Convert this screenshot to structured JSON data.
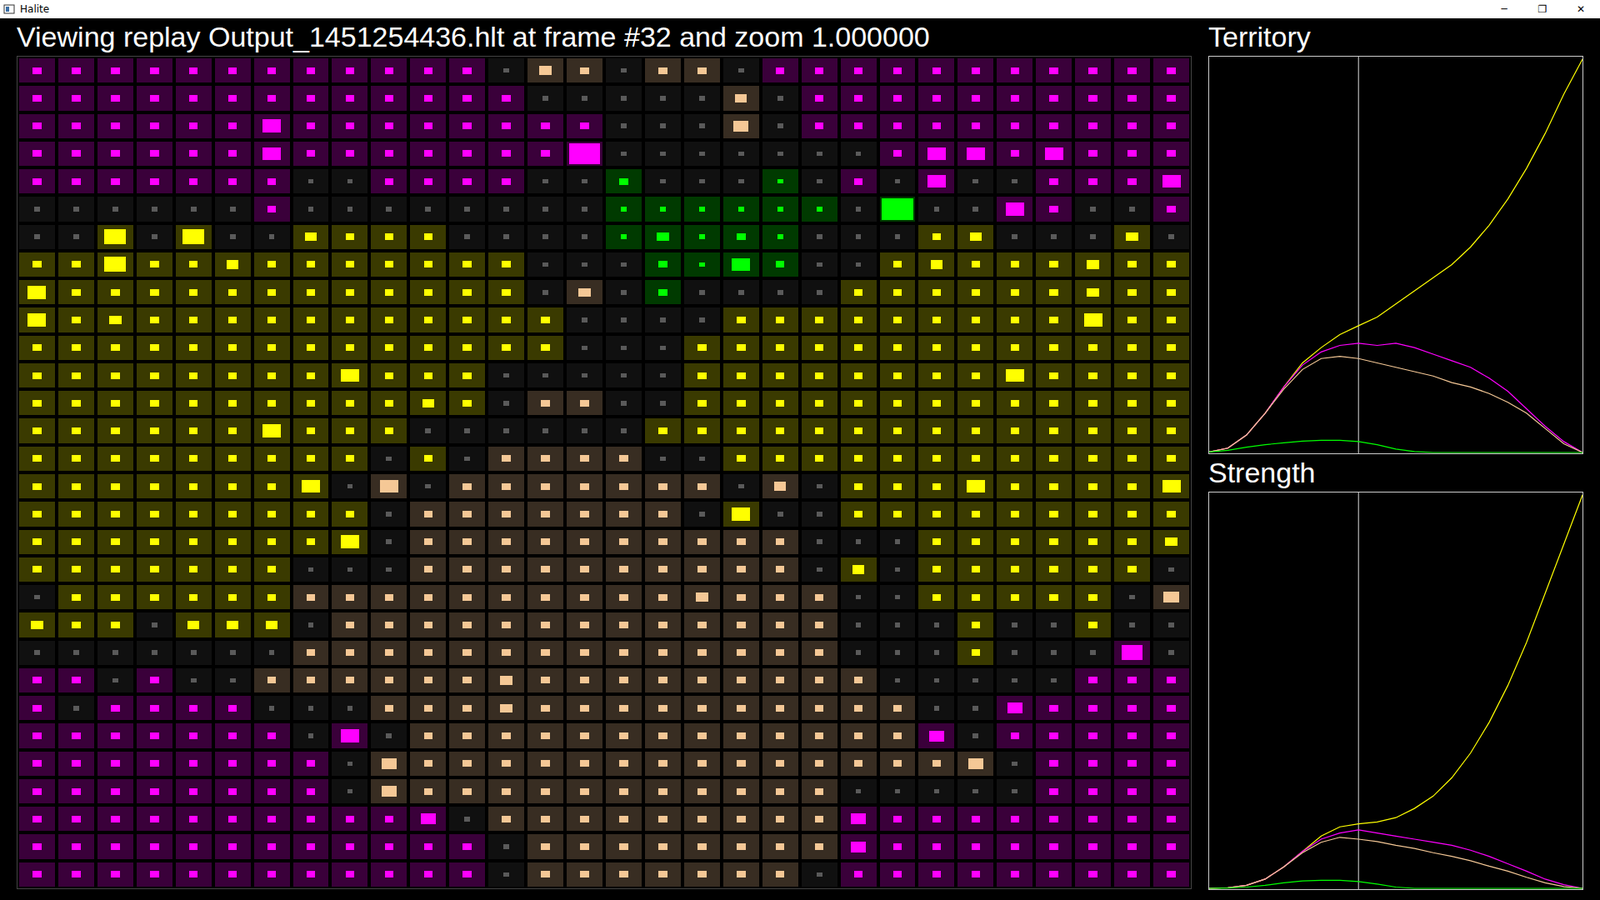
{
  "window": {
    "title": "Halite",
    "controls": [
      "─",
      "❐",
      "✕"
    ]
  },
  "header": "Viewing replay Output_1451254436.hlt at frame #32 and zoom 1.000000",
  "players": [
    {
      "code": "M",
      "color": "#ff00ff"
    },
    {
      "code": "Y",
      "color": "#ffff00"
    },
    {
      "code": "T",
      "color": "#f5c896"
    },
    {
      "code": "G",
      "color": "#00ff00"
    }
  ],
  "map": {
    "rows": [
      {
        "owners": "MMMMMMMMMMMMNTTNTTNMMMMMMMMMMM",
        "strength": "222222222222132122122222222222"
      },
      {
        "owners": "MMMMMMMMMMMMMNNNNNTNMMMMMMMMMM",
        "strength": "222222222222211111312222222222"
      },
      {
        "owners": "MMMMMMMMMMMMMMMNNNTNMMMMMMMMMM",
        "strength": "222222522222222111412222222222"
      },
      {
        "owners": "MMMMMMMMMMMMMMMNNNNNNNMMMMMMMM",
        "strength": "222222522222229111111125525222"
      },
      {
        "owners": "MMMMMMMNNMMMMNNGNNNGNMNMNNMMMM",
        "strength": "222222211222211211111215112225"
      },
      {
        "owners": "NNNNNNMNNNNNNNNGGGGGGNGNNMMNNM",
        "strength": "111111211111111111111191152112"
      },
      {
        "owners": "NNYNYNNYYYYNNNNGGGGGNNNYYNNNYN",
        "strength": "116161132221111131211112311131"
      },
      {
        "owners": "YYYYYYYYYYYYYNNNGGGGNNYYYYYYYY",
        "strength": "226223222222211121521123222322"
      },
      {
        "owners": "YYYYYYYYYYYYYNTNGNNNNYYYYYYYYY",
        "strength": "522222222222213121111222222322"
      },
      {
        "owners": "YYYYYYYYYYYYYYNNNNYYYYYYYYYYYY",
        "strength": "523222222222221111222222222522"
      },
      {
        "owners": "YYYYYYYYYYYYYYNNNYYYYYYYYYYYYY",
        "strength": "222222222222221112222222222222"
      },
      {
        "owners": "YYYYYYYYYYYYNNNNNYYYYYYYYYYYYY",
        "strength": "222222225222111112222222252222"
      },
      {
        "owners": "YYYYYYYYYYYYNTTNNYYYYYYYYYYYYY",
        "strength": "222222222232122112222222222222"
      },
      {
        "owners": "YYYYYYYYYYNNNNNNYYYYYYYYYYYYYY",
        "strength": "222222522211111122222222222222"
      },
      {
        "owners": "YYYYYYYYYNYNTTTTNNYYYYYYYYYYYY",
        "strength": "222222222121222211222222222222"
      },
      {
        "owners": "YYYYYYYYNTNTTTTTTTNTNYYYYYYYYY",
        "strength": "222222251512222222131222522225"
      },
      {
        "owners": "YYYYYYYYYNTTTTTTTNYNNYYYYYYYYY",
        "strength": "222222222122222221511222222222"
      },
      {
        "owners": "YYYYYYYYYNTTTTTTTTTTNNNYYYYYYY",
        "strength": "222222225122222222221112222223"
      },
      {
        "owners": "YYYYYYYNNNTTTTTTTTTTNYNYYYYYYN",
        "strength": "222222211122222222221312222221"
      },
      {
        "owners": "NYYYYYYTTTTTTTTTTTTTTNNYYYYYNT",
        "strength": "122222222222222223222112222214"
      },
      {
        "owners": "YYYNYYYNTTTTTTTTTTTTTNNNYNNYNN",
        "strength": "322133312222222222222111211211"
      },
      {
        "owners": "NNNNNNNTTTTTTTTTTTTTTNNNYNNNMN",
        "strength": "111111122222222222222111211161"
      },
      {
        "owners": "MMNMNNTTTTTTTTTTTTTTTTNNNNNMMM",
        "strength": "221211222222322222222211111222"
      },
      {
        "owners": "MNMMMMNNNTTTTTTTTTTTTTTNNMMMMM",
        "strength": "212222111222322222222221142222"
      },
      {
        "owners": "MMMMMMMNMNTTTTTTTTTTTTTMNMMMMM",
        "strength": "222222215122222222222224122222"
      },
      {
        "owners": "MMMMMMMMNTTTTTTTTTTTTTTTTNMMMM",
        "strength": "222222221422222222222222412222"
      },
      {
        "owners": "MMMMMMMMNTTTTTTTTTTTTNNNNNMMMM",
        "strength": "222222221422222222222111112222"
      },
      {
        "owners": "MMMMMMMMMMMNTTTTTTTTTMMMMMMMMM",
        "strength": "222222222241222222222422222222"
      },
      {
        "owners": "MMMMMMMMMMMMNTTTTTTTTMMMMMMMMM",
        "strength": "222222222222122222222422222222"
      },
      {
        "owners": "MMMMMMMMMMMMNTTTTTTTNMMMMMMMMM",
        "strength": "222222222222122222221222222222"
      }
    ]
  },
  "charts": [
    {
      "title": "Territory",
      "marker_frame": 32,
      "frame_step": 4,
      "series": [
        {
          "player": "Y",
          "values": [
            1,
            10,
            40,
            90,
            150,
            205,
            240,
            270,
            290,
            310,
            340,
            370,
            400,
            430,
            470,
            520,
            580,
            650,
            730,
            820,
            900
          ]
        },
        {
          "player": "M",
          "values": [
            1,
            10,
            40,
            90,
            150,
            200,
            230,
            245,
            250,
            245,
            250,
            240,
            225,
            210,
            195,
            170,
            140,
            100,
            60,
            25,
            0
          ]
        },
        {
          "player": "T",
          "values": [
            1,
            10,
            40,
            90,
            145,
            190,
            215,
            220,
            215,
            205,
            195,
            185,
            175,
            160,
            150,
            135,
            115,
            90,
            55,
            20,
            0
          ]
        },
        {
          "player": "G",
          "values": [
            1,
            5,
            12,
            18,
            22,
            26,
            28,
            28,
            25,
            18,
            8,
            2,
            0,
            0,
            0,
            0,
            0,
            0,
            0,
            0,
            0
          ]
        }
      ]
    },
    {
      "title": "Strength",
      "marker_frame": 32,
      "frame_step": 4,
      "series": [
        {
          "player": "Y",
          "values": [
            0,
            100,
            500,
            1500,
            3500,
            6000,
            8500,
            10000,
            10500,
            10800,
            11500,
            13000,
            15000,
            18000,
            22000,
            27000,
            33000,
            40000,
            48000,
            56000,
            64000
          ]
        },
        {
          "player": "M",
          "values": [
            0,
            100,
            500,
            1500,
            3500,
            6000,
            8000,
            9000,
            9500,
            9000,
            8500,
            8000,
            7500,
            7000,
            6200,
            5200,
            4000,
            2800,
            1500,
            600,
            0
          ]
        },
        {
          "player": "T",
          "values": [
            0,
            100,
            500,
            1500,
            3500,
            5800,
            7500,
            8300,
            8000,
            7600,
            7000,
            6500,
            5800,
            5200,
            4500,
            3600,
            2800,
            1800,
            900,
            300,
            0
          ]
        },
        {
          "player": "G",
          "values": [
            0,
            50,
            200,
            500,
            900,
            1200,
            1300,
            1300,
            1100,
            700,
            200,
            0,
            0,
            0,
            0,
            0,
            0,
            0,
            0,
            0,
            0
          ]
        }
      ]
    }
  ]
}
